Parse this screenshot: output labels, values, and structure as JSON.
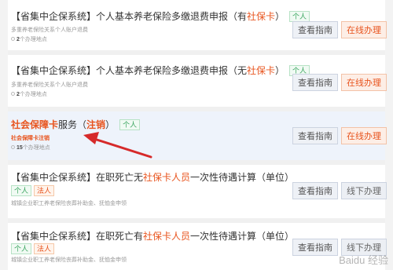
{
  "items": [
    {
      "title": "【省集中企保系统】个人基本养老保险多缴退费申报（有",
      "title_red": "社保卡",
      "title_end": "）",
      "badge": "个人",
      "subtitle": "多重养老保险关系个人账户退费",
      "location_count": "2",
      "location_suffix": "个办理地点",
      "guide_label": "查看指南",
      "action_label": "在线办理"
    },
    {
      "title": "【省集中企保系统】个人基本养老保险多缴退费申报（无",
      "title_red": "社保卡",
      "title_end": "）",
      "badge": "个人",
      "subtitle": "多重养老保险关系个人账户退费",
      "location_count": "2",
      "location_suffix": "个办理地点",
      "guide_label": "查看指南",
      "action_label": "在线办理"
    },
    {
      "title_red": "社会保障卡",
      "title_mid": "服务（",
      "title_red2": "注销",
      "title_end": "）",
      "badge": "个人",
      "subtitle": "社会保障卡注销",
      "location_count": "15",
      "location_suffix": "个办理地点",
      "guide_label": "查看指南",
      "action_label": "在线办理"
    },
    {
      "title": "【省集中企保系统】在职死亡无",
      "title_red": "社保卡人员",
      "title_end": "一次性待遇计算（单位）",
      "badge1": "个人",
      "badge2": "法人",
      "subtitle": "城镇企业职工养老保险丧葬补助金、抚恤金申领",
      "guide_label": "查看指南",
      "action_label": "线下办理"
    },
    {
      "title": "【省集中企保系统】在职死亡有",
      "title_red": "社保卡人员",
      "title_end": "一次性待遇计算（单位）",
      "badge1": "个人",
      "badge2": "法人",
      "subtitle": "城镇企业职工养老保险丧葬补助金、抚恤金申领",
      "guide_label": "查看指南",
      "action_label": "线下办理"
    }
  ],
  "watermark": "Baidu 经验",
  "colors": {
    "accent": "#e8541e",
    "badge_green": "#3aa55f",
    "highlight_bg": "#eef3fb",
    "arrow": "#d62a2a"
  },
  "icons": [
    "location-pin-icon",
    "red-arrow-annotation"
  ]
}
